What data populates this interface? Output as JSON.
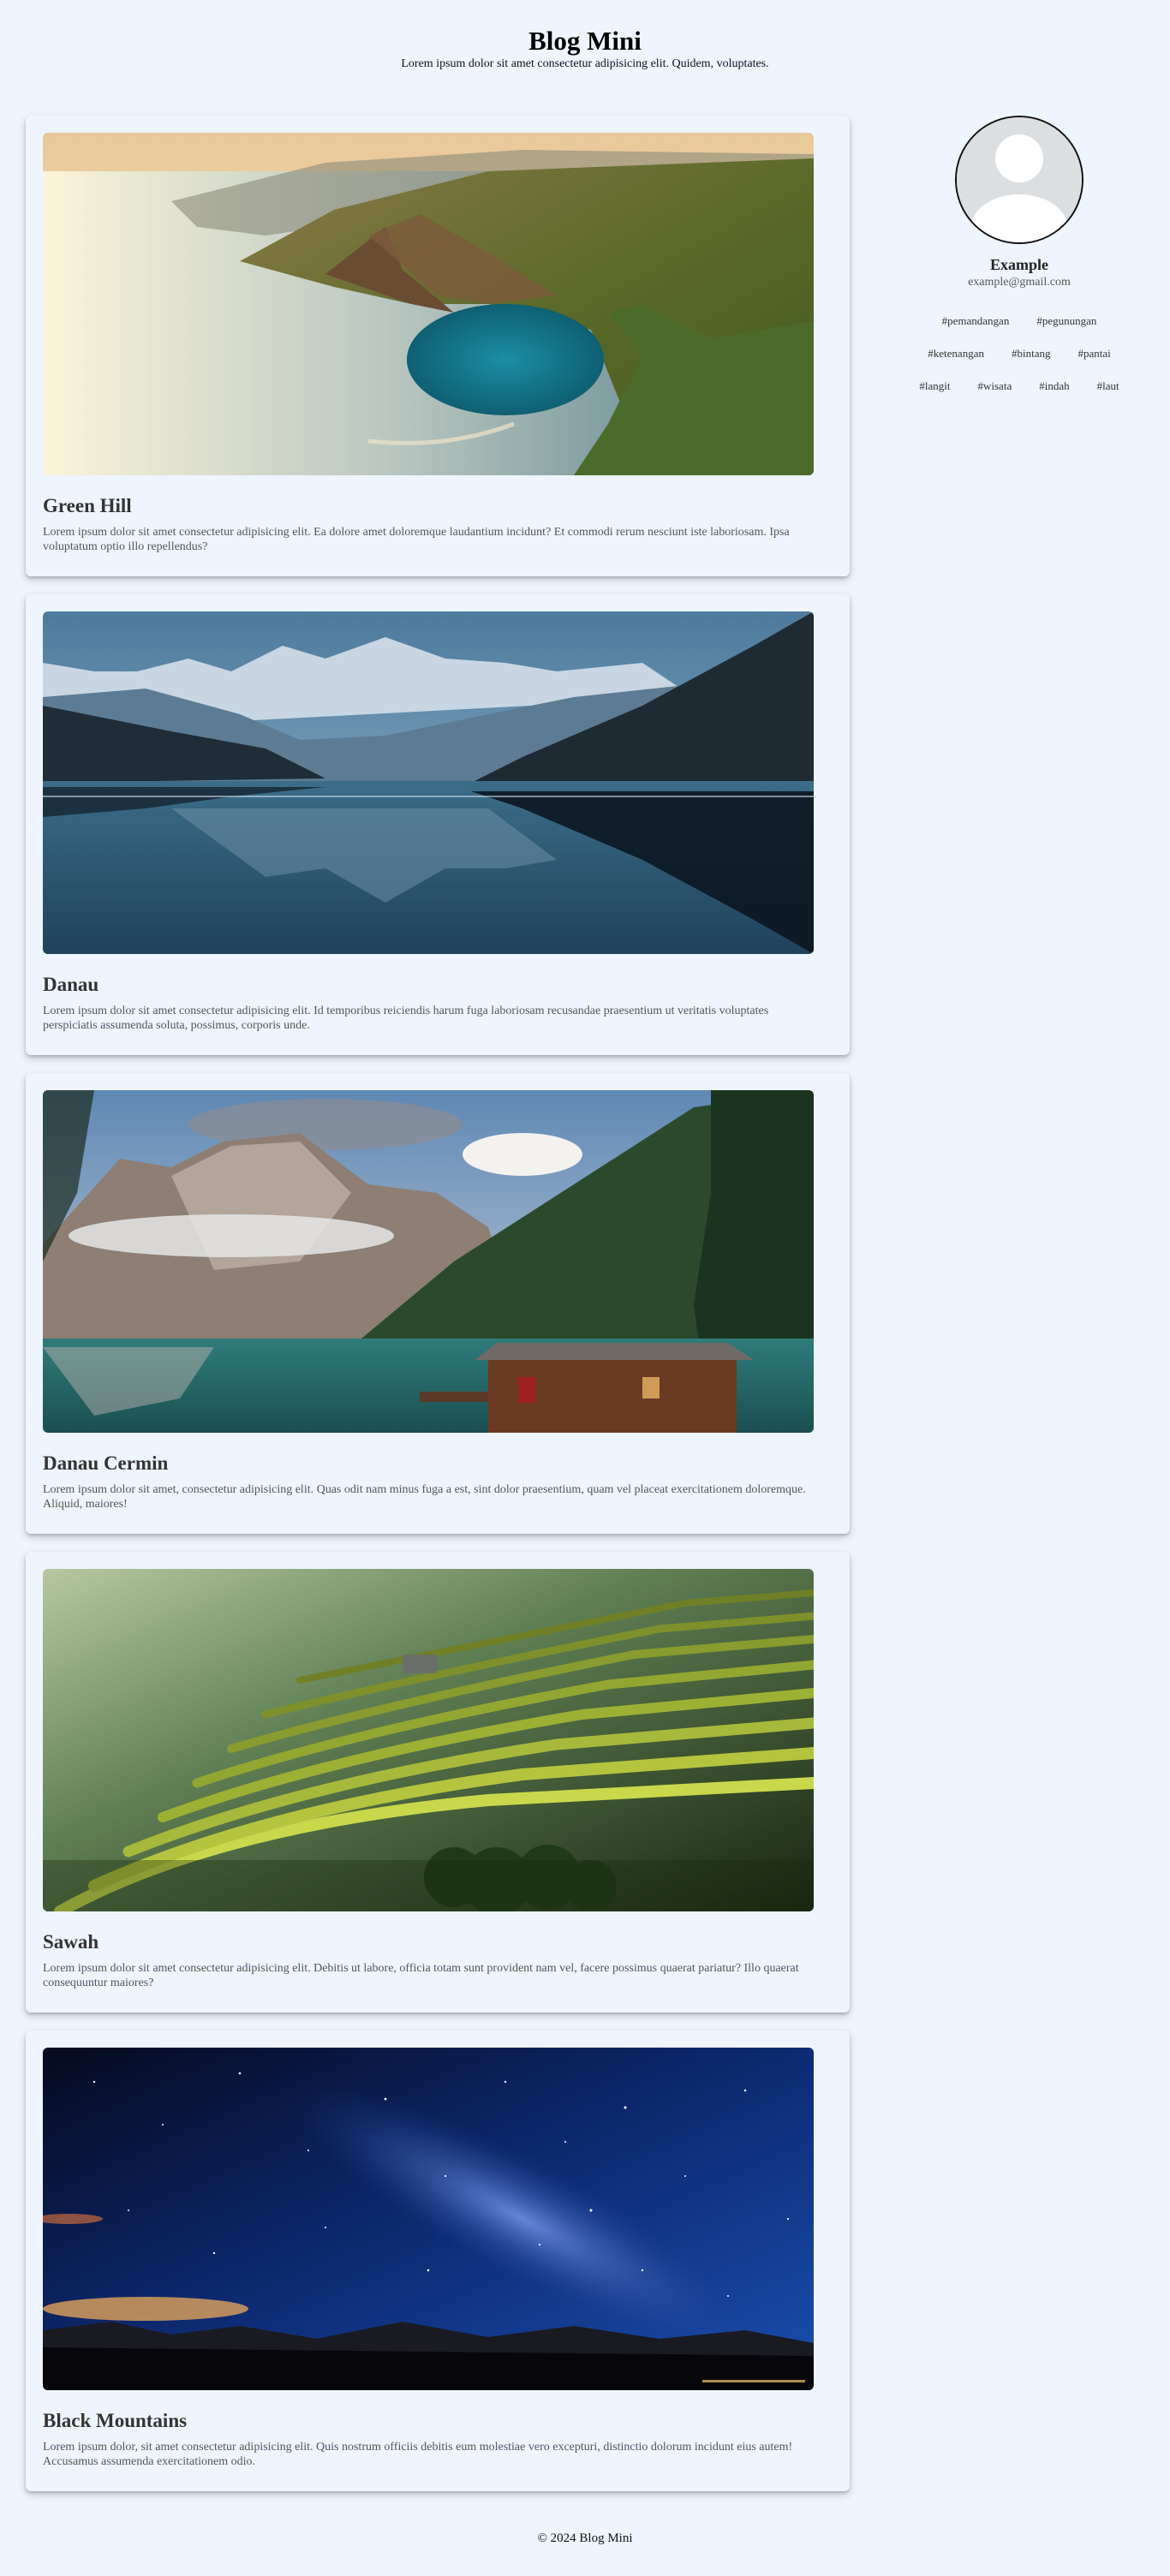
{
  "site": {
    "title": "Blog Mini",
    "tagline": "Lorem ipsum dolor sit amet consectetur adipisicing elit. Quidem, voluptates."
  },
  "posts": [
    {
      "title": "Green Hill",
      "excerpt": "Lorem ipsum dolor sit amet consectetur adipisicing elit. Ea dolore amet doloremque laudantium incidunt? Et commodi rerum nesciunt iste laboriosam. Ipsa voluptatum optio illo repellendus?"
    },
    {
      "title": "Danau",
      "excerpt": "Lorem ipsum dolor sit amet consectetur adipisicing elit. Id temporibus reiciendis harum fuga laboriosam recusandae praesentium ut veritatis voluptates perspiciatis assumenda soluta, possimus, corporis unde."
    },
    {
      "title": "Danau Cermin",
      "excerpt": "Lorem ipsum dolor sit amet, consectetur adipisicing elit. Quas odit nam minus fuga a est, sint dolor praesentium, quam vel placeat exercitationem doloremque. Aliquid, maiores!"
    },
    {
      "title": "Sawah",
      "excerpt": "Lorem ipsum dolor sit amet consectetur adipisicing elit. Debitis ut labore, officia totam sunt provident nam vel, facere possimus quaerat pariatur? Illo quaerat consequuntur maiores?"
    },
    {
      "title": "Black Mountains",
      "excerpt": "Lorem ipsum dolor, sit amet consectetur adipisicing elit. Quis nostrum officiis debitis eum molestiae vero excepturi, distinctio dolorum incidunt eius autem! Accusamus assumenda exercitationem odio."
    }
  ],
  "profile": {
    "name": "Example",
    "email": "example@gmail.com",
    "avatar_icon": "user-avatar-icon"
  },
  "tags": [
    "#pemandangan",
    "#pegunungan",
    "#ketenangan",
    "#bintang",
    "#pantai",
    "#langit",
    "#wisata",
    "#indah",
    "#laut"
  ],
  "footer": {
    "text": "© 2024 Blog Mini"
  },
  "colors": {
    "background": "#eef5ff",
    "heading": "#333333",
    "body_text": "#555555"
  }
}
